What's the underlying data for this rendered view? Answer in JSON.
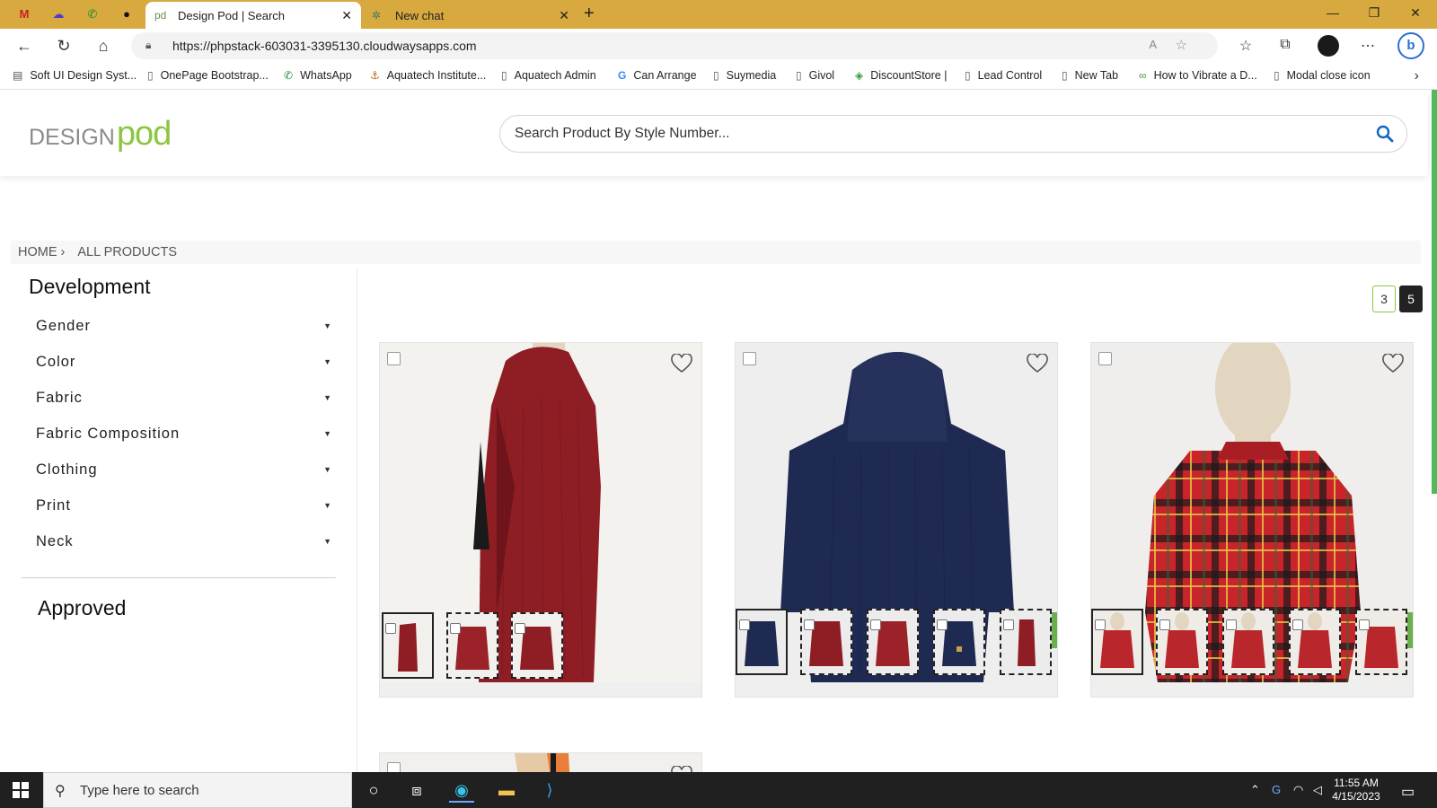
{
  "browser": {
    "tabs": [
      {
        "title": "Design Pod | Search",
        "active": true
      },
      {
        "title": "New chat",
        "active": false
      }
    ],
    "new_tab": "+",
    "url": "https://phpstack-603031-3395130.cloudwaysapps.com",
    "bookmarks": [
      "Soft UI Design Syst...",
      "OnePage Bootstrap...",
      "WhatsApp",
      "Aquatech Institute...",
      "Aquatech Admin",
      "Can Arrange",
      "Suymedia",
      "Givol",
      "DiscountStore |",
      "Lead Control",
      "New Tab",
      "How to Vibrate a D...",
      "Modal close icon"
    ]
  },
  "site": {
    "logo_part1": "DESIGN",
    "logo_part2": "pod",
    "search_placeholder": "Search Product By Style Number...",
    "brand_green": "#8cc63f"
  },
  "breadcrumb": {
    "home": "HOME",
    "current": "ALL PRODUCTS"
  },
  "sidebar": {
    "section1": "Development",
    "filters": [
      "Gender",
      "Color",
      "Fabric",
      "Fabric Composition",
      "Clothing",
      "Print",
      "Neck"
    ],
    "section2": "Approved"
  },
  "pagination": {
    "options": [
      "3",
      "5"
    ],
    "active": "5"
  },
  "products": [
    {
      "color": "#8e1d24",
      "thumbs": [
        "#8e1d24",
        "#9b2229",
        "#8e1d24"
      ]
    },
    {
      "color": "#1f2a52",
      "thumbs": [
        "#1f2a52",
        "#8e1d24",
        "#9b2229",
        "#1f2a52",
        "#8e1d24"
      ]
    },
    {
      "color": "#c8242a",
      "thumbs": [
        "#b9262b",
        "#b9262b",
        "#b9262b",
        "#b9262b",
        "#b9262b"
      ]
    }
  ],
  "taskbar": {
    "search_placeholder": "Type here to search",
    "time": "11:55 AM",
    "date": "4/15/2023"
  }
}
